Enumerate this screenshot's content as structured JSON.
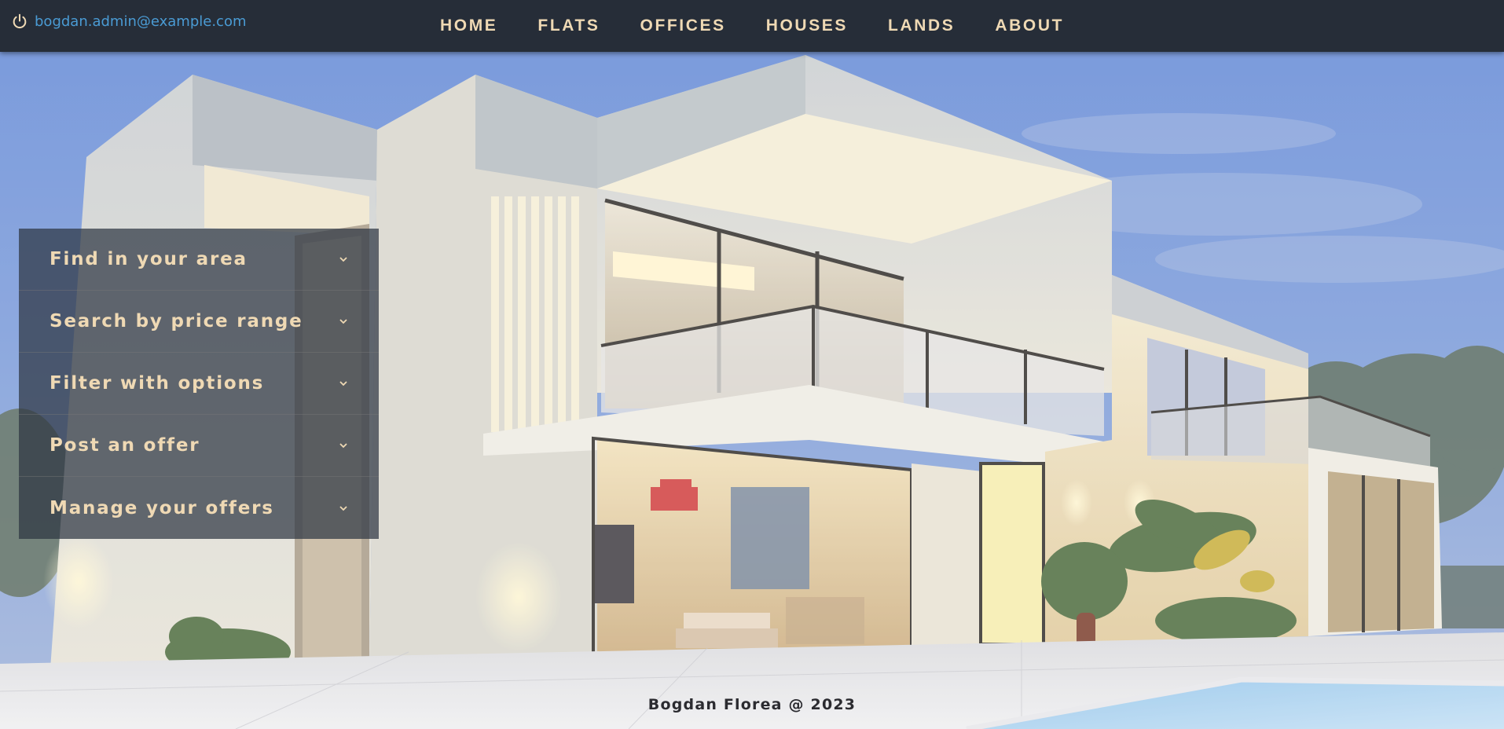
{
  "user": {
    "icon": "power-icon",
    "email": "bogdan.admin@example.com"
  },
  "nav": {
    "items": [
      "HOME",
      "FLATS",
      "OFFICES",
      "HOUSES",
      "LANDS",
      "ABOUT"
    ]
  },
  "side_menu": {
    "items": [
      {
        "label": "Find in your area",
        "icon": "chevron-down-icon"
      },
      {
        "label": "Search by price range",
        "icon": "chevron-down-icon"
      },
      {
        "label": "Filter with options",
        "icon": "chevron-down-icon"
      },
      {
        "label": "Post an offer",
        "icon": "chevron-down-icon"
      },
      {
        "label": "Manage your offers",
        "icon": "chevron-down-icon"
      }
    ]
  },
  "footer": {
    "text": "Bogdan Florea @ 2023"
  },
  "colors": {
    "navbar_bg": "#262d38",
    "nav_text": "#efd9b4",
    "email_link": "#4a9bd4",
    "menu_bg": "#2e3642",
    "footer_text": "#2b2b30"
  }
}
